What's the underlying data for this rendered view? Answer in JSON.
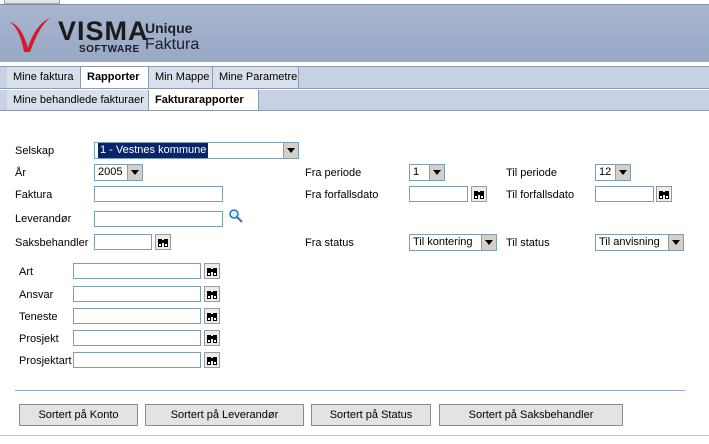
{
  "brand": {
    "name": "VISMA",
    "sub": "SOFTWARE",
    "title_line1": "Unique",
    "title_line2": "Faktura"
  },
  "nav": {
    "tabs": [
      {
        "label": "Mine faktura"
      },
      {
        "label": "Rapporter",
        "active": true
      },
      {
        "label": "Min Mappe"
      },
      {
        "label": "Mine Parametre"
      }
    ],
    "subtabs": [
      {
        "label": "Mine behandlede fakturaer"
      },
      {
        "label": "Fakturarapporter",
        "active": true
      }
    ]
  },
  "form": {
    "selskap": {
      "label": "Selskap",
      "value": "1 - Vestnes kommune"
    },
    "ar": {
      "label": "År",
      "value": "2005"
    },
    "faktura": {
      "label": "Faktura"
    },
    "leverandor": {
      "label": "Leverandør"
    },
    "saksbehandler": {
      "label": "Saksbehandler"
    },
    "fra_periode": {
      "label": "Fra periode",
      "value": "1"
    },
    "til_periode": {
      "label": "Til periode",
      "value": "12"
    },
    "fra_forfallsdato": {
      "label": "Fra forfallsdato"
    },
    "til_forfallsdato": {
      "label": "Til forfallsdato"
    },
    "fra_status": {
      "label": "Fra status",
      "value": "Til kontering"
    },
    "til_status": {
      "label": "Til status",
      "value": "Til anvisning"
    },
    "art": {
      "label": "Art"
    },
    "ansvar": {
      "label": "Ansvar"
    },
    "teneste": {
      "label": "Teneste"
    },
    "prosjekt": {
      "label": "Prosjekt"
    },
    "prosjektart": {
      "label": "Prosjektart"
    }
  },
  "buttons": {
    "konto": "Sortert på Konto",
    "leverandor": "Sortert på Leverandør",
    "status": "Sortert på Status",
    "saksbehandler": "Sortert på Saksbehandler"
  },
  "colors": {
    "header": "#9eadca",
    "nav": "#c7d1e3",
    "selection": "#0a246a"
  },
  "icons": [
    "binoculars-icon",
    "magnifier-icon",
    "dropdown-arrow-icon",
    "visma-logo"
  ]
}
